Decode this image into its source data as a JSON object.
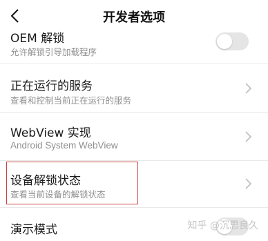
{
  "header": {
    "title": "开发者选项",
    "back_icon": "chevron-left-icon"
  },
  "rows": [
    {
      "title": "OEM 解锁",
      "subtitle": "允许解锁引导加载程序",
      "control": "toggle",
      "toggle_on": false
    },
    {
      "title": "正在运行的服务",
      "subtitle": "查看和控制当前正在运行的服务",
      "control": "chevron-right-icon"
    },
    {
      "title": "WebView 实现",
      "subtitle": "Android System WebView",
      "control": "chevron-right-icon"
    },
    {
      "title": "设备解锁状态",
      "subtitle": "查看当前设备的解锁状态",
      "control": "chevron-right-icon",
      "highlighted": true,
      "highlight_color": "#c8433f"
    },
    {
      "title": "演示模式",
      "control": "toggle",
      "toggle_on": false
    }
  ],
  "watermark": "知乎 @沉思良久",
  "colors": {
    "background": "#ffffff",
    "title": "#1a1a1a",
    "subtitle": "#8f8f8f",
    "divider": "#e9e9e9",
    "toggle_off": "#e5e5e5",
    "chevron": "#bdbdbd"
  }
}
